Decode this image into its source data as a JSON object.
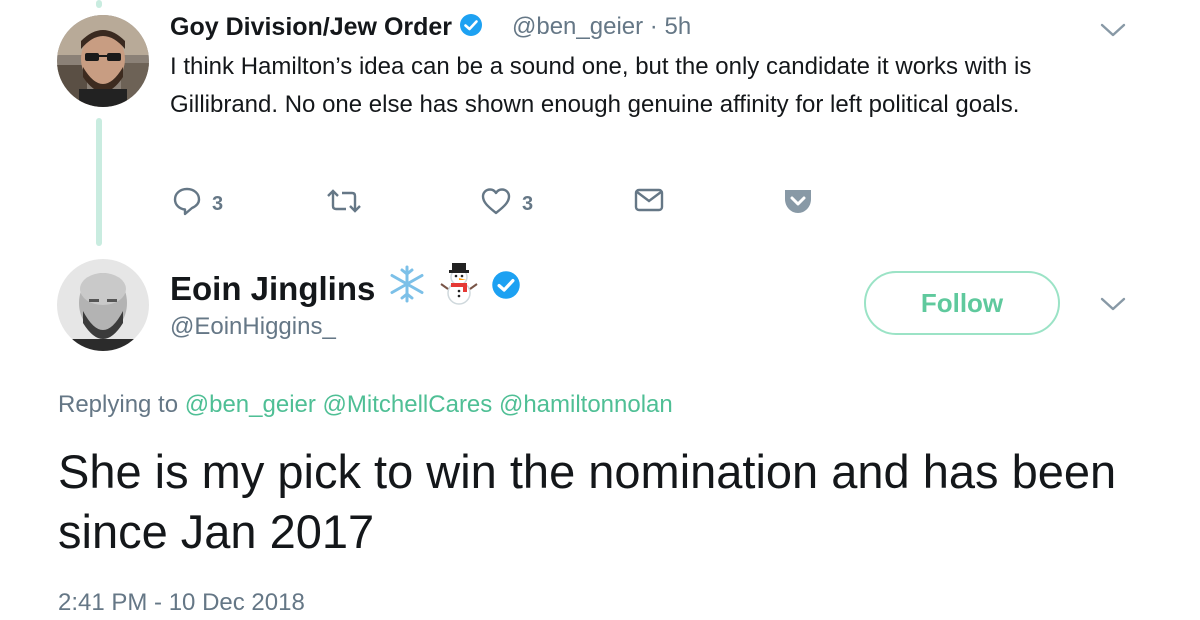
{
  "tweet1": {
    "display_name": "Goy Division/Jew Order",
    "handle": "@ben_geier",
    "separator": "·",
    "age": "5h",
    "text": "I think Hamilton’s idea can be a sound one, but the only candidate it works with is Gillibrand. No one else has shown enough genuine affinity for left political goals.",
    "reply_count": "3",
    "like_count": "3",
    "actions": [
      "reply-icon",
      "retweet-icon",
      "like-icon",
      "message-icon",
      "pocket-icon"
    ]
  },
  "tweet2": {
    "display_name": "Eoin Jinglins",
    "name_emojis": [
      "snowflake",
      "snowman"
    ],
    "handle": "@EoinHiggins_",
    "follow_label": "Follow",
    "replying_prefix": "Replying to",
    "replying_to": [
      "@ben_geier",
      "@MitchellCares",
      "@hamiltonnolan"
    ],
    "text": "She is my pick to win the nomination and has been since Jan 2017",
    "timestamp": "2:41 PM - 10 Dec 2018"
  },
  "colors": {
    "verified": "#1da1f2",
    "accent_green": "#5fc99d",
    "thread_line": "#c9ece0",
    "muted": "#657786",
    "pocket": "#8899a6"
  }
}
